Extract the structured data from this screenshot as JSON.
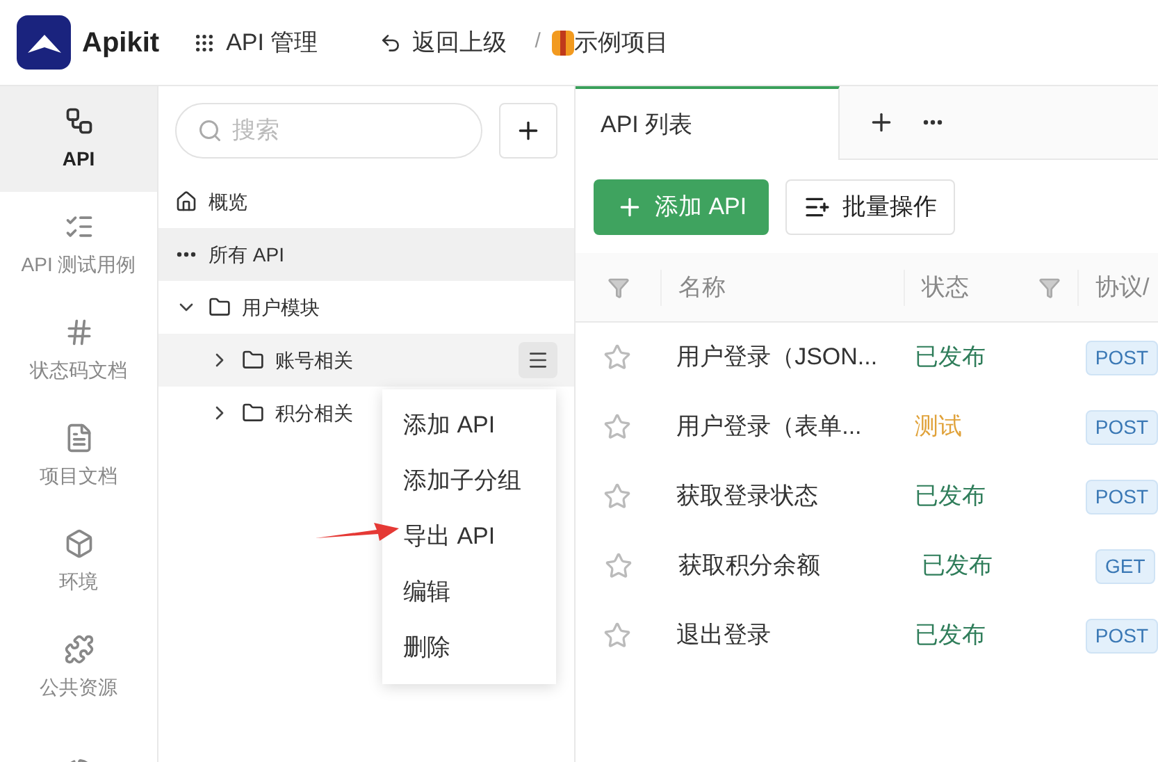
{
  "header": {
    "logo_text": "Apikit",
    "module": "API 管理",
    "back": "返回上级",
    "separator": "/",
    "project": "示例项目"
  },
  "nav": [
    {
      "kind": "api",
      "label": "API",
      "selected": true
    },
    {
      "kind": "testcase",
      "label": "API 测试用例",
      "selected": false
    },
    {
      "kind": "statuscode",
      "label": "状态码文档",
      "selected": false
    },
    {
      "kind": "doc",
      "label": "项目文档",
      "selected": false
    },
    {
      "kind": "env",
      "label": "环境",
      "selected": false
    },
    {
      "kind": "resource",
      "label": "公共资源",
      "selected": false
    },
    {
      "kind": "stats",
      "selected": false
    }
  ],
  "search": {
    "placeholder": "搜索"
  },
  "tree": [
    {
      "kind": "home",
      "label": "概览",
      "selected": false
    },
    {
      "kind": "all",
      "label": "所有 API",
      "selected": true
    },
    {
      "kind": "folder",
      "label": "用户模块",
      "selected": false,
      "expanded": true,
      "children": [
        {
          "kind": "folder",
          "label": "账号相关",
          "expanded": false,
          "menu_open": true
        },
        {
          "kind": "folder",
          "label": "积分相关",
          "expanded": false,
          "menu_open": false
        }
      ]
    }
  ],
  "context_menu": [
    "添加 API",
    "添加子分组",
    "导出 API",
    "编辑",
    "删除"
  ],
  "tabs": [
    {
      "label": "API 列表",
      "selected": true
    }
  ],
  "toolbar": {
    "add": "添加 API",
    "batch": "批量操作"
  },
  "table": {
    "columns": [
      "名称",
      "状态",
      "协议/"
    ],
    "rows": [
      {
        "starred": false,
        "name": "用户登录（JSON...",
        "status": "已发布",
        "color": "#2f7d5a",
        "method": "POST"
      },
      {
        "starred": false,
        "name": "用户登录（表单...",
        "status": "测试",
        "color": "#e0a23a",
        "method": "POST"
      },
      {
        "starred": false,
        "name": "获取登录状态",
        "status": "已发布",
        "color": "#2f7d5a",
        "method": "POST"
      },
      {
        "starred": false,
        "name": "获取积分余额",
        "status": "已发布",
        "color": "#2f7d5a",
        "method": "GET"
      },
      {
        "starred": false,
        "name": "退出登录",
        "status": "已发布",
        "color": "#2f7d5a",
        "method": "POST"
      }
    ]
  }
}
